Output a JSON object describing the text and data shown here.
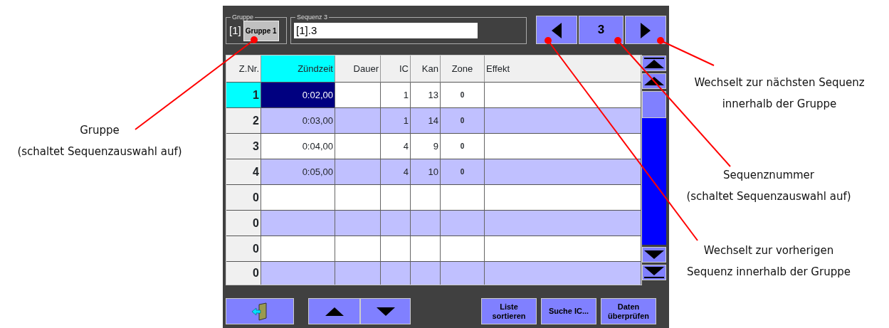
{
  "group": {
    "legend": "Gruppe",
    "index": "[1]",
    "button": "Gruppe 1"
  },
  "sequence": {
    "legend": "Sequenz 3",
    "value": "[1].3",
    "number": "3"
  },
  "table": {
    "columns": [
      {
        "label": "Z.Nr.",
        "selected": false
      },
      {
        "label": "Zündzeit",
        "selected": true
      },
      {
        "label": "Dauer",
        "selected": false
      },
      {
        "label": "IC",
        "selected": false
      },
      {
        "label": "Kan",
        "selected": false
      },
      {
        "label": "Zone",
        "selected": false
      },
      {
        "label": "Effekt",
        "selected": false
      }
    ],
    "rows": [
      {
        "nr": "1",
        "zuendzeit": "0:02,00",
        "ic": "1",
        "kan": "13",
        "zone": "0",
        "selected": true
      },
      {
        "nr": "2",
        "zuendzeit": "0:03,00",
        "ic": "1",
        "kan": "14",
        "zone": "0",
        "selected": false
      },
      {
        "nr": "3",
        "zuendzeit": "0:04,00",
        "ic": "4",
        "kan": "9",
        "zone": "0",
        "selected": false
      },
      {
        "nr": "4",
        "zuendzeit": "0:05,00",
        "ic": "4",
        "kan": "10",
        "zone": "0",
        "selected": false
      },
      {
        "nr": "0",
        "selected": false
      },
      {
        "nr": "0",
        "selected": false
      },
      {
        "nr": "0",
        "selected": false
      },
      {
        "nr": "0",
        "selected": false
      }
    ]
  },
  "buttons": [
    {
      "label": "Liste sortieren"
    },
    {
      "label": "Suche IC..."
    },
    {
      "label": "Daten überprüfen"
    }
  ],
  "callouts": [
    {
      "lines": [
        "Gruppe",
        "(schaltet Sequenzauswahl auf)"
      ]
    },
    {
      "lines": [
        "Wechselt zur nächsten Sequenz",
        "innerhalb der Gruppe"
      ]
    },
    {
      "lines": [
        "Sequenznummer",
        "(schaltet Sequenzauswahl auf)"
      ]
    },
    {
      "lines": [
        "Wechselt zur vorherigen",
        "Sequenz innerhalb der Gruppe"
      ]
    }
  ]
}
